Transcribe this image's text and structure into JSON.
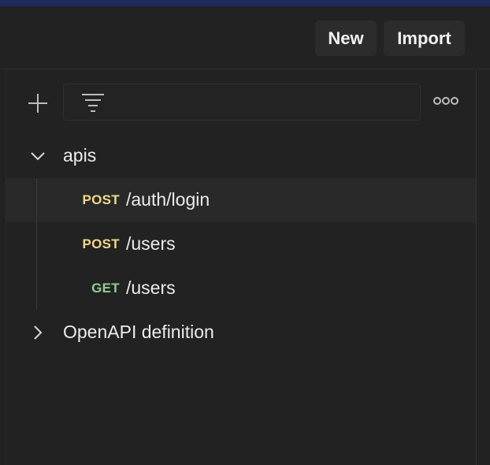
{
  "header": {
    "new_label": "New",
    "import_label": "Import"
  },
  "toolbar": {
    "search_placeholder": "",
    "icons": [
      "plus-icon",
      "filter-icon",
      "more-icon"
    ]
  },
  "collections": [
    {
      "name": "apis",
      "expanded": true,
      "requests": [
        {
          "method": "POST",
          "path": "/auth/login",
          "selected": true
        },
        {
          "method": "POST",
          "path": "/users",
          "selected": false
        },
        {
          "method": "GET",
          "path": "/users",
          "selected": false
        }
      ]
    },
    {
      "name": "OpenAPI definition",
      "expanded": false,
      "requests": []
    }
  ],
  "colors": {
    "post": "#f0d98a",
    "get": "#8fce94",
    "background": "#222222",
    "topbar": "#1c2a5c"
  }
}
